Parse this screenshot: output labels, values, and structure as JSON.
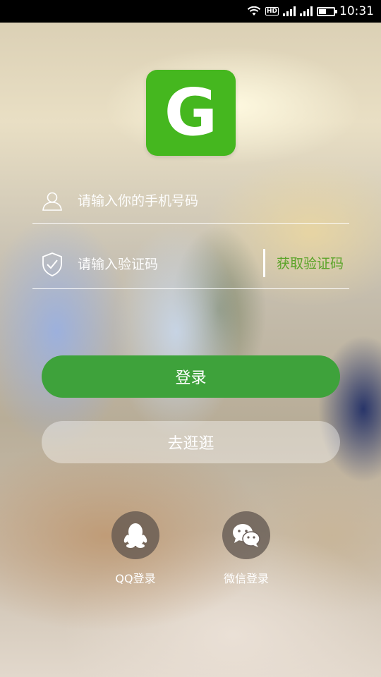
{
  "status_bar": {
    "time": "10:31",
    "network_label": "HD",
    "battery_level": 0.45
  },
  "logo": {
    "letter": "G",
    "color": "#45b71f"
  },
  "phone_field": {
    "placeholder": "请输入你的手机号码",
    "value": ""
  },
  "code_field": {
    "placeholder": "请输入验证码",
    "value": ""
  },
  "get_code_label": "获取验证码",
  "login_button": {
    "label": "登录",
    "color": "#3ea23b"
  },
  "browse_button": {
    "label": "去逛逛"
  },
  "social_login": [
    {
      "label": "QQ登录",
      "icon": "qq-icon"
    },
    {
      "label": "微信登录",
      "icon": "wechat-icon"
    }
  ],
  "accent_color": "#5aa428"
}
